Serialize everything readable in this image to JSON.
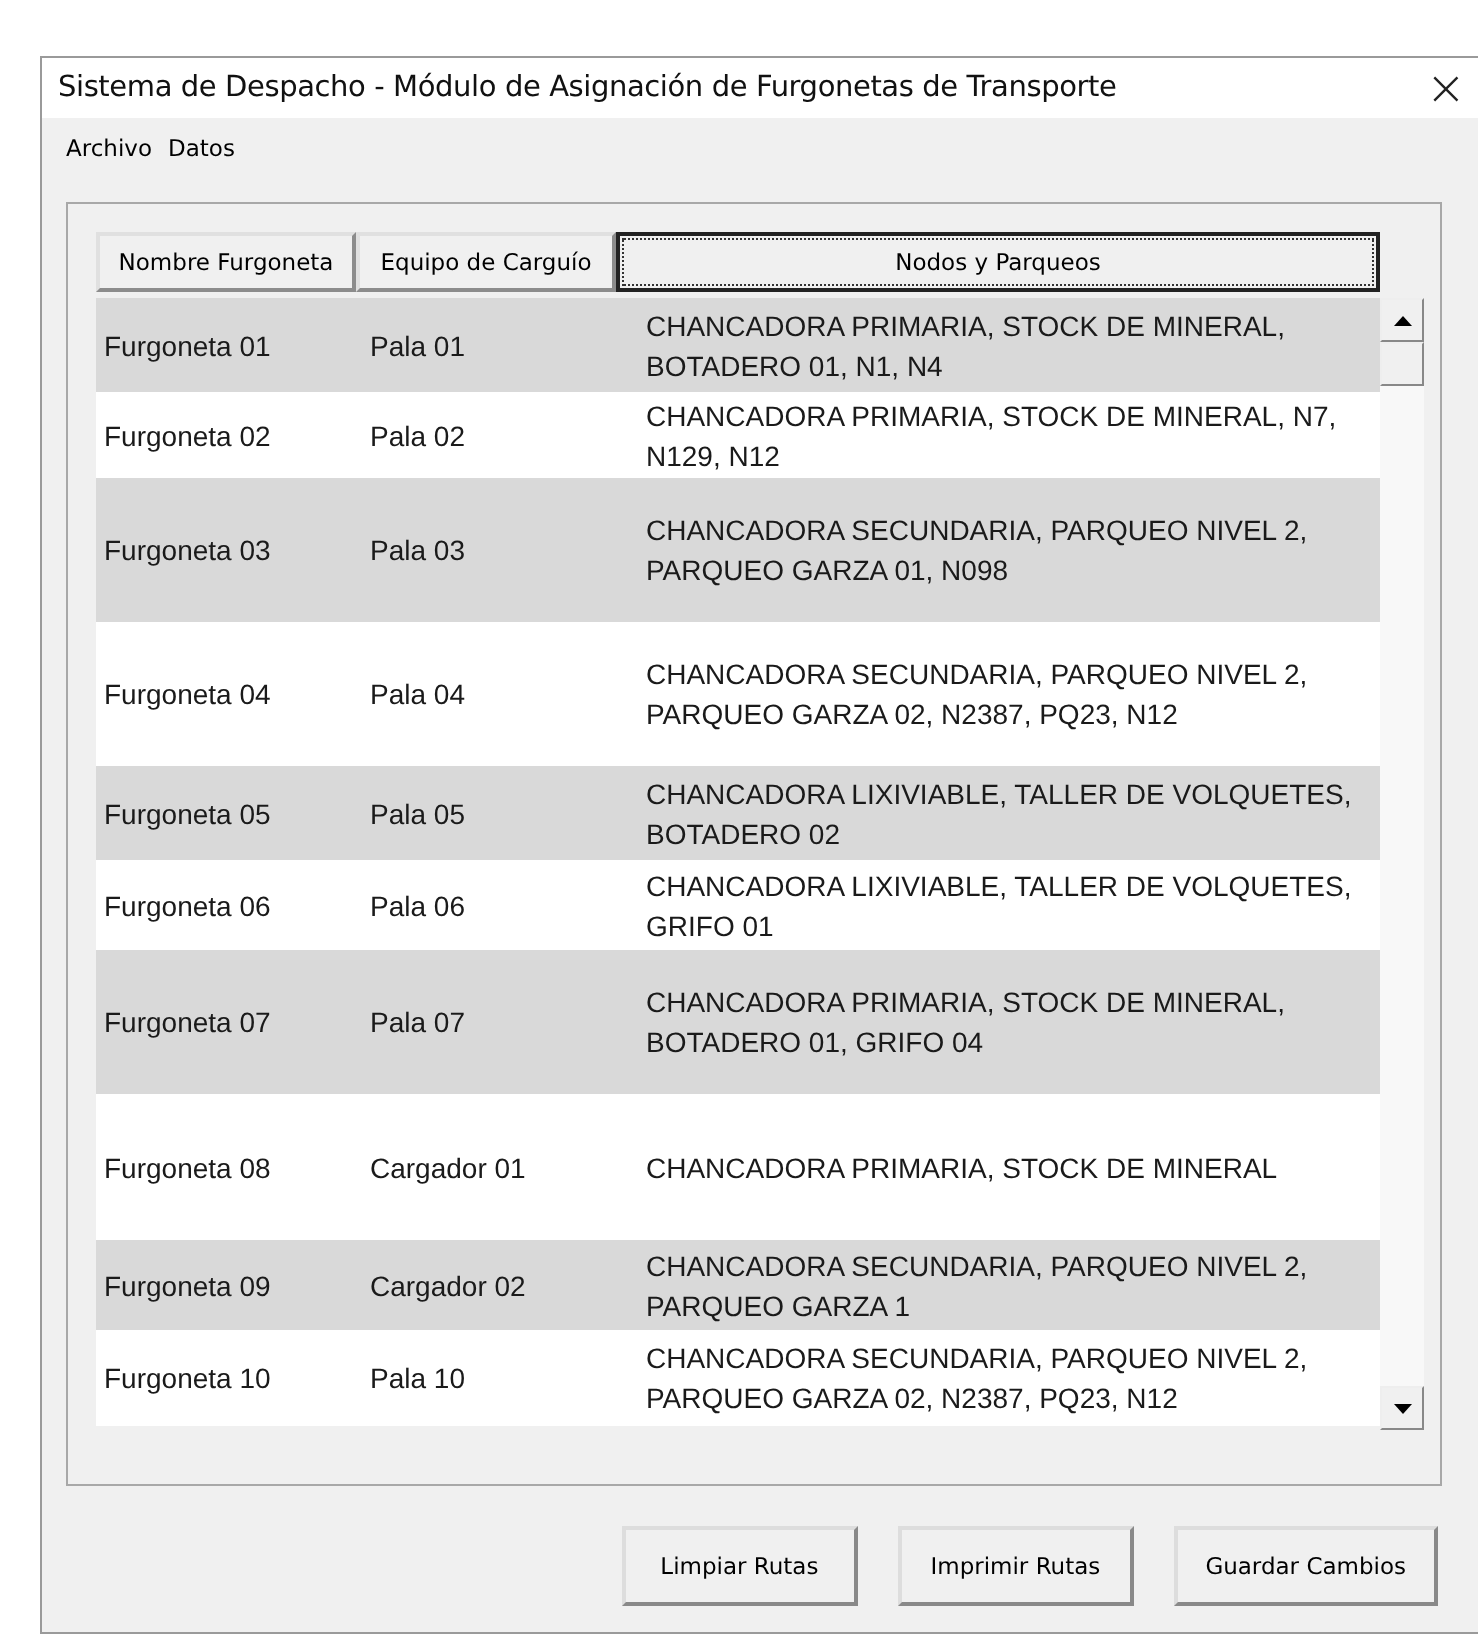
{
  "window": {
    "title": "Sistema de Despacho - Módulo de Asignación de Furgonetas de Transporte",
    "close": "×"
  },
  "menu": [
    "Archivo",
    "Datos"
  ],
  "table": {
    "columns": [
      {
        "label": "Nombre Furgoneta",
        "selected": false
      },
      {
        "label": "Equipo de Carguío",
        "selected": false
      },
      {
        "label": "Nodos y Parqueos",
        "selected": true
      }
    ],
    "rows": [
      [
        "Furgoneta 01",
        "Pala 01",
        "CHANCADORA PRIMARIA, STOCK DE MINERAL, BOTADERO 01, N1, N4"
      ],
      [
        "Furgoneta 02",
        "Pala 02",
        "CHANCADORA PRIMARIA, STOCK DE MINERAL, N7, N129, N12"
      ],
      [
        "Furgoneta 03",
        "Pala 03",
        "CHANCADORA SECUNDARIA, PARQUEO NIVEL 2, PARQUEO GARZA 01, N098"
      ],
      [
        "Furgoneta 04",
        "Pala 04",
        "CHANCADORA SECUNDARIA, PARQUEO NIVEL 2, PARQUEO GARZA 02, N2387, PQ23, N12"
      ],
      [
        "Furgoneta 05",
        "Pala 05",
        "CHANCADORA LIXIVIABLE, TALLER DE VOLQUETES, BOTADERO 02"
      ],
      [
        "Furgoneta 06",
        "Pala 06",
        "CHANCADORA LIXIVIABLE, TALLER DE VOLQUETES, GRIFO 01"
      ],
      [
        "Furgoneta 07",
        "Pala 07",
        "CHANCADORA PRIMARIA, STOCK DE MINERAL, BOTADERO 01, GRIFO 04"
      ],
      [
        "Furgoneta 08",
        "Cargador 01",
        "CHANCADORA PRIMARIA, STOCK DE MINERAL"
      ],
      [
        "Furgoneta 09",
        "Cargador 02",
        "CHANCADORA SECUNDARIA, PARQUEO NIVEL 2, PARQUEO GARZA 1"
      ],
      [
        "Furgoneta 10",
        "Pala 10",
        "CHANCADORA SECUNDARIA, PARQUEO NIVEL 2, PARQUEO GARZA 02, N2387, PQ23, N12"
      ]
    ]
  },
  "buttons": [
    "Limpiar Rutas",
    "Imprimir Rutas",
    "Guardar Cambios"
  ]
}
